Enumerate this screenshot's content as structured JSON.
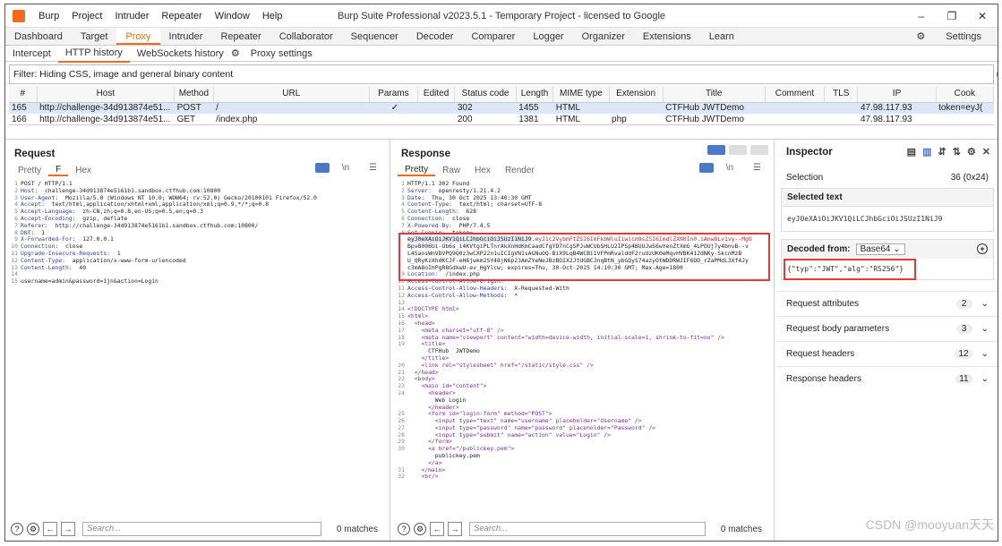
{
  "app": {
    "menu": [
      "Burp",
      "Project",
      "Intruder",
      "Repeater",
      "Window",
      "Help"
    ],
    "window_title": "Burp Suite Professional v2023.5.1 - Temporary Project - licensed to Google"
  },
  "main_tabs": [
    "Dashboard",
    "Target",
    "Proxy",
    "Intruder",
    "Repeater",
    "Collaborator",
    "Sequencer",
    "Decoder",
    "Comparer",
    "Logger",
    "Organizer",
    "Extensions",
    "Learn"
  ],
  "settings_label": "Settings",
  "proxy_tabs": [
    "Intercept",
    "HTTP history",
    "WebSockets history",
    "Proxy settings"
  ],
  "filter_text": "Filter: Hiding CSS, image and general binary content",
  "history": {
    "columns": [
      "#",
      "Host",
      "Method",
      "URL",
      "Params",
      "Edited",
      "Status code",
      "Length",
      "MIME type",
      "Extension",
      "Title",
      "Comment",
      "TLS",
      "IP",
      "Cook"
    ],
    "rows": [
      [
        "165",
        "http://challenge-34d913874e51...",
        "POST",
        "/",
        "✓",
        "",
        "302",
        "1455",
        "HTML",
        "",
        "CTFHub JWTDemo",
        "",
        "",
        "47.98.117.93",
        "token=eyJ("
      ],
      [
        "166",
        "http://challenge-34d913874e51...",
        "GET",
        "/index.php",
        "",
        "",
        "200",
        "1381",
        "HTML",
        "php",
        "CTFHub JWTDemo",
        "",
        "",
        "47.98.117.93",
        ""
      ]
    ]
  },
  "request": {
    "title": "Request",
    "tabs": [
      "Pretty",
      "F",
      "Hex"
    ],
    "lines": [
      [
        "1",
        "POST / HTTP/1.1"
      ],
      [
        "2",
        "Host:  challenge-34d913874e5161b1.sandbox.ctfhub.com:10800"
      ],
      [
        "3",
        "User-Agent:  Mozilla/5.0 (Windows NT 10.0; WOW64; rv:52.0) Gecko/20100101 Firefox/52.0"
      ],
      [
        "4",
        "Accept:  text/html,application/xhtml+xml,application/xml;q=0.9,*/*;q=0.8"
      ],
      [
        "5",
        "Accept-Language:  zh-CN,zh;q=0.8,en-US;q=0.5,en;q=0.3"
      ],
      [
        "6",
        "Accept-Encoding:  gzip, deflate"
      ],
      [
        "7",
        "Referer:  http://challenge-34d913874e5161b1.sandbox.ctfhub.com:10800/"
      ],
      [
        "8",
        "DNT:  1"
      ],
      [
        "9",
        "X-Forwarded-For:  127.0.0.1"
      ],
      [
        "10",
        "Connection:  close"
      ],
      [
        "11",
        "Upgrade-Insecure-Requests:  1"
      ],
      [
        "12",
        "Content-Type:  application/x-www-form-urlencoded"
      ],
      [
        "13",
        "Content-Length:  40"
      ],
      [
        "14",
        ""
      ],
      [
        "15",
        "username=admin&password=1jn&action=Login"
      ]
    ]
  },
  "response": {
    "title": "Response",
    "tabs": [
      "Pretty",
      "Raw",
      "Hex",
      "Render"
    ],
    "lines": [
      [
        "1",
        "HTTP/1.1 302 Found"
      ],
      [
        "2",
        "Server:  openresty/1.21.4.2"
      ],
      [
        "3",
        "Date:  Thu, 30 Oct 2025 13:40:30 GMT"
      ],
      [
        "4",
        "Content-Type:  text/html; charset=UTF-8"
      ],
      [
        "5",
        "Content-Length:  628"
      ],
      [
        "6",
        "Connection:  close"
      ],
      [
        "7",
        "X-Powered-By:  PHP/7.4.5"
      ],
      [
        "8",
        "Set-Cookie:  token="
      ],
      [
        "",
        "eyJ0eXAiOiJKV1QiLCJhbGciOiJSUzI1NiJ9.eyJ1c2VybmFtZSI6ImFkbWluIiwicm9sZSI6ImdlZXN0In0.iAnw8Lv1vy--MgO"
      ],
      [
        "",
        "Bpv8006Ui-Ub6s_i4KVtgiPLTnrAkXnHdKmCaadCfgYD7nCgSPJuWCUbSHLU2IPSp4BUUJw56wYenZtXmG_4LPOUj7y4bnvB--v"
      ],
      [
        "",
        "L4SaosWnVDVPQ9Q0z3wCXP22n1uICIgVN1sAGNuOQ-BiX9LqB4WCBi1VFPmRvalddF2ruUzUK0eMqvHVBK412dNKy-SkcnMzB"
      ],
      [
        "",
        "U_QRyKzXhdKCJF-eH6jwkm2SY48jN6p23AmZYeNeJBzBOIX2JtUGBCJnqBtN_ybGQyS74azyOtWDDRWJIF6DD_rZaPMdL3Xf4Jy"
      ],
      [
        "",
        "c3mA8oIhPgR8GdkwU-ev_HgYlcw; expires=Thu, 30-Oct-2025 14:10:30 GMT; Max-Age=1800"
      ],
      [
        "9",
        "Location:  /index.php"
      ],
      [
        "10",
        "Access-Control-Allow-Origin:  *"
      ],
      [
        "11",
        "Access-Control-Allow-Headers:  X-Requested-With"
      ],
      [
        "12",
        "Access-Control-Allow-Methods:  *"
      ],
      [
        "13",
        ""
      ],
      [
        "14",
        "<!DOCTYPE html>"
      ],
      [
        "15",
        "<html>"
      ],
      [
        "16",
        "  <head>"
      ],
      [
        "17",
        "    <meta charset=\"utf-8\" />"
      ],
      [
        "18",
        "    <meta name=\"viewport\" content=\"width=device-width, initial-scale=1, shrink-to-fit=no\" />"
      ],
      [
        "19",
        "    <title>"
      ],
      [
        "",
        "      CTFHub  JWTDemo"
      ],
      [
        "",
        "    </title>"
      ],
      [
        "20",
        "    <link rel=\"stylesheet\" href=\"/static/style.css\" />"
      ],
      [
        "21",
        "  </head>"
      ],
      [
        "22",
        "  <body>"
      ],
      [
        "23",
        "    <main id=\"content\">"
      ],
      [
        "24",
        "      <header>"
      ],
      [
        "",
        "        Web Login"
      ],
      [
        "",
        "      </header>"
      ],
      [
        "25",
        "      <form id=\"login-form\" method=\"POST\">"
      ],
      [
        "26",
        "        <input type=\"text\" name=\"username\" placeholder=\"Username\" />"
      ],
      [
        "27",
        "        <input type=\"password\" name=\"password\" placeholder=\"Password\" />"
      ],
      [
        "28",
        "        <input type=\"submit\" name=\"action\" value=\"Login\" />"
      ],
      [
        "29",
        "      </form>"
      ],
      [
        "30",
        "      <a href=\"/publickey.pem\">"
      ],
      [
        "",
        "        publickey.pem"
      ],
      [
        "",
        "      </a>"
      ],
      [
        "31",
        "    </main>"
      ],
      [
        "32",
        "    <br/>"
      ]
    ]
  },
  "inspector": {
    "title": "Inspector",
    "selection_label": "Selection",
    "selection_value": "36 (0x24)",
    "selected_text_label": "Selected text",
    "selected_text": "eyJ0eXAiOiJKV1QiLCJhbGciOiJSUzI1NiJ9",
    "decoded_from_label": "Decoded from:",
    "decoded_from_value": "Base64",
    "decoded_text": "{\"typ\":\"JWT\",\"alg\":\"RS256\"}",
    "sections": [
      {
        "label": "Request attributes",
        "count": "2"
      },
      {
        "label": "Request body parameters",
        "count": "3"
      },
      {
        "label": "Request headers",
        "count": "12"
      },
      {
        "label": "Response headers",
        "count": "11"
      }
    ]
  },
  "search": {
    "placeholder": "Search...",
    "matches": "0 matches"
  },
  "watermark": "CSDN @mooyuan天天"
}
